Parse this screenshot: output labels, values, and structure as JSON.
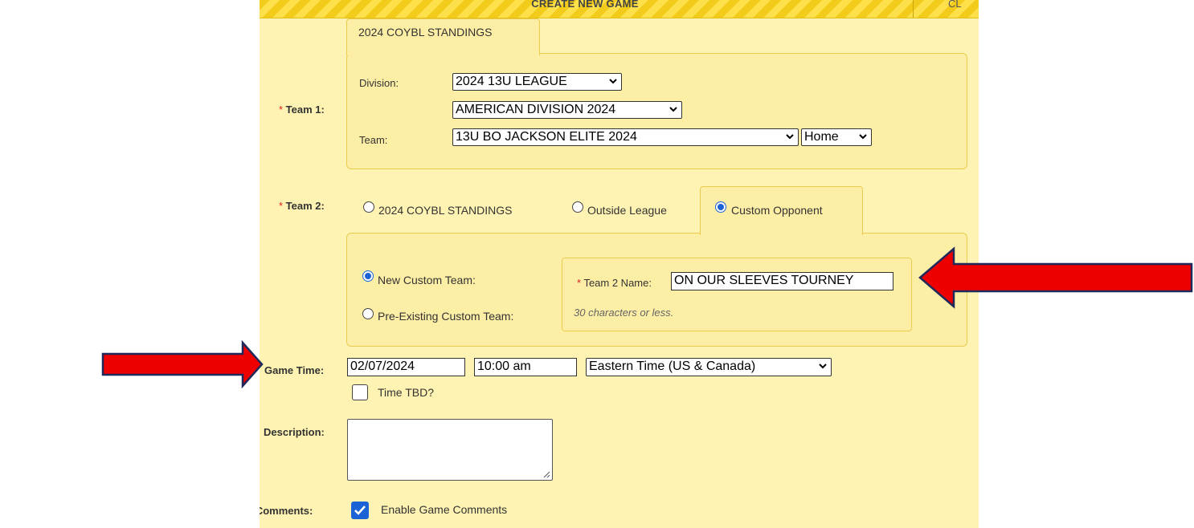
{
  "header": {
    "title": "CREATE NEW GAME",
    "next_tab_fragment": "CL"
  },
  "team1": {
    "label": "Team 1:",
    "tab_label": "2024 COYBL STANDINGS",
    "division_label": "Division:",
    "division_value": "2024 13U LEAGUE",
    "subdivision_value": "AMERICAN DIVISION 2024",
    "team_label": "Team:",
    "team_value": "13U BO JACKSON ELITE 2024",
    "home_away_value": "Home"
  },
  "team2": {
    "label": "Team 2:",
    "options": [
      {
        "label": "2024 COYBL STANDINGS",
        "selected": false
      },
      {
        "label": "Outside League",
        "selected": false
      },
      {
        "label": "Custom Opponent",
        "selected": true
      }
    ],
    "custom": {
      "new_label": "New Custom Team:",
      "new_selected": true,
      "existing_label": "Pre-Existing Custom Team:",
      "existing_selected": false,
      "name_label": "Team 2 Name:",
      "name_value": "ON OUR SLEEVES TOURNEY",
      "name_hint": "30 characters or less."
    }
  },
  "game_time": {
    "label": "Game Time:",
    "date": "02/07/2024",
    "time": "10:00 am",
    "timezone": "Eastern Time (US & Canada)",
    "tbd_label": "Time TBD?",
    "tbd_checked": false
  },
  "description": {
    "label": "Description:",
    "value": ""
  },
  "comments": {
    "label": "e Comments:",
    "checkbox_label": "Enable Game Comments",
    "checked": true
  },
  "colors": {
    "panel": "#fef3b2",
    "box": "#fdeea6",
    "arrow": "#ee0000",
    "arrow_outline": "#1f2a5a",
    "accent": "#1a62d6"
  }
}
